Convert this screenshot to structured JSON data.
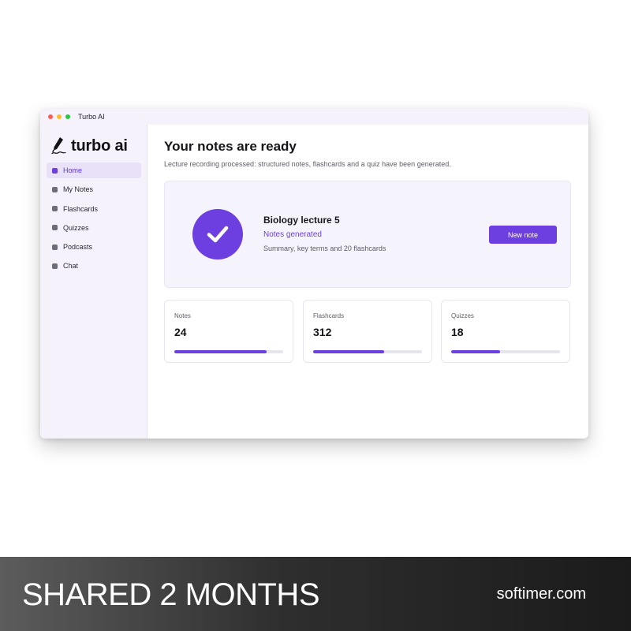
{
  "window": {
    "title": "Turbo AI"
  },
  "sidebar": {
    "logo_text": "turbo ai",
    "items": [
      {
        "label": "Home",
        "active": true
      },
      {
        "label": "My Notes",
        "active": false
      },
      {
        "label": "Flashcards",
        "active": false
      },
      {
        "label": "Quizzes",
        "active": false
      },
      {
        "label": "Podcasts",
        "active": false
      },
      {
        "label": "Chat",
        "active": false
      }
    ]
  },
  "main": {
    "title": "Your notes are ready",
    "subtitle": "Lecture recording processed: structured notes, flashcards and a quiz have been generated.",
    "status_card": {
      "icon": "check-circle-icon",
      "lecture_title": "Biology lecture 5",
      "status": "Notes generated",
      "summary": "Summary, key terms and 20 flashcards",
      "button_label": "New note"
    },
    "stats": [
      {
        "label": "Notes",
        "value": "24",
        "progress": 0.85
      },
      {
        "label": "Flashcards",
        "value": "312",
        "progress": 0.65
      },
      {
        "label": "Quizzes",
        "value": "18",
        "progress": 0.45
      }
    ]
  },
  "banner": {
    "left_text": "SHARED 2 MONTHS",
    "right_text": "softimer.com"
  },
  "colors": {
    "accent": "#6d3fe0",
    "sidebar_bg": "#f5f2fb",
    "active_item_bg": "#e8e1f8"
  }
}
